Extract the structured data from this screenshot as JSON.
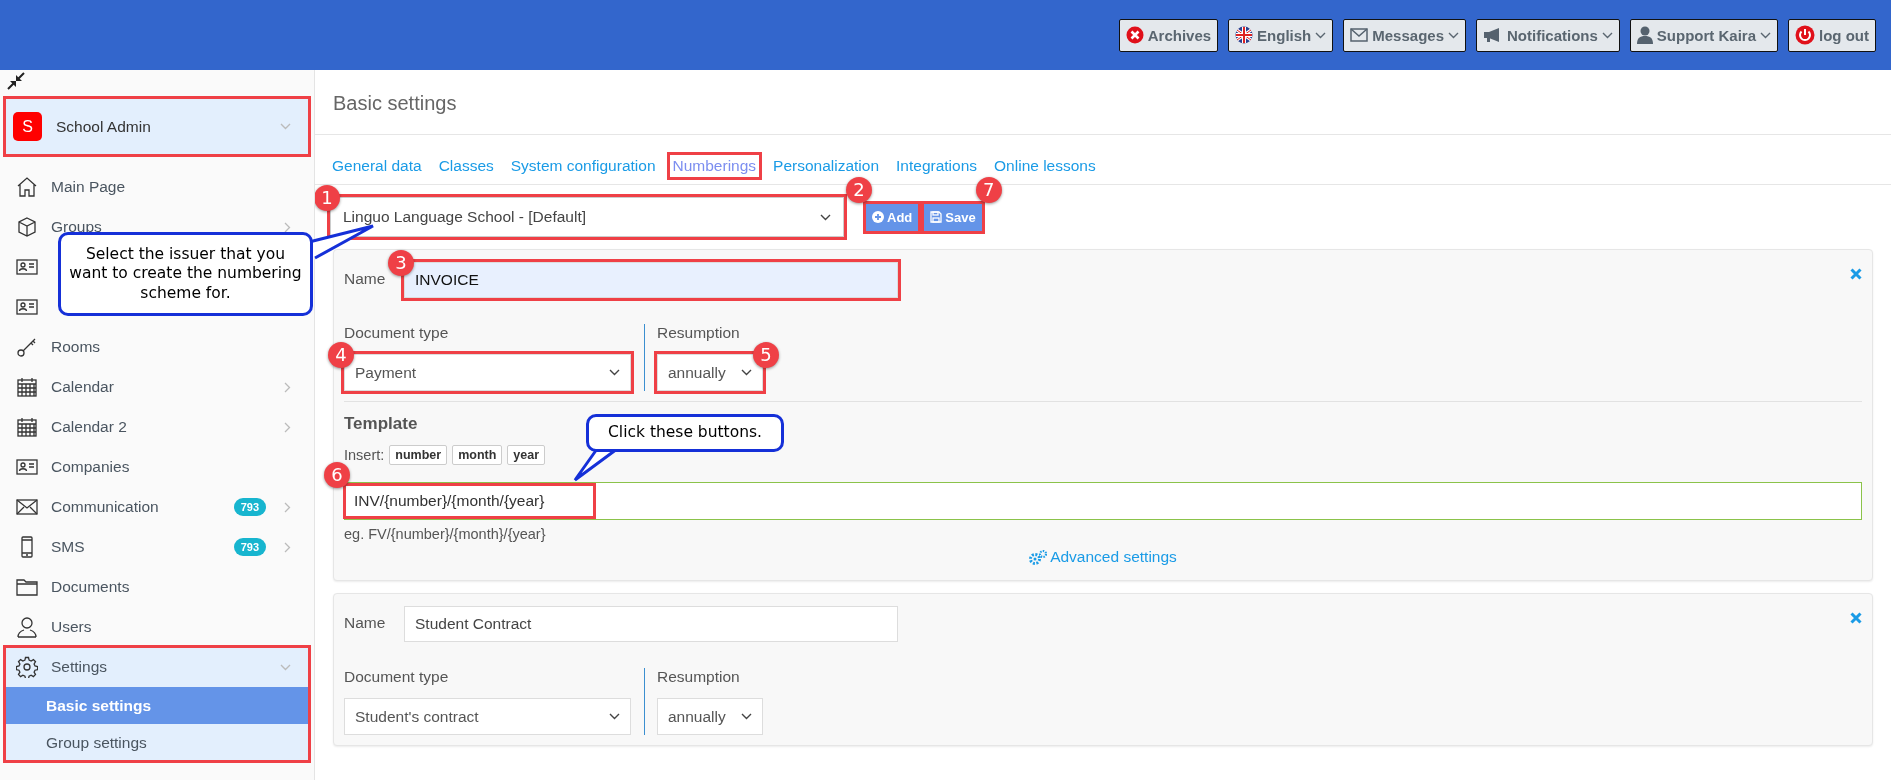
{
  "top_bar": {
    "buttons": [
      {
        "kind": "archives",
        "label": "Archives",
        "dropdown": false
      },
      {
        "kind": "language",
        "label": "English",
        "dropdown": true
      },
      {
        "kind": "messages",
        "label": "Messages",
        "dropdown": true
      },
      {
        "kind": "notifications",
        "label": "Notifications",
        "dropdown": true
      },
      {
        "kind": "user",
        "label": "Support Kaira",
        "dropdown": true
      },
      {
        "kind": "logout",
        "label": "log out",
        "dropdown": false
      }
    ]
  },
  "sidebar": {
    "organization": {
      "initial": "S",
      "name": "School Admin",
      "highlighted": true
    },
    "items": [
      {
        "kind": "home",
        "label": "Main Page",
        "submenu": false
      },
      {
        "kind": "cube",
        "label": "Groups",
        "submenu": true
      },
      {
        "kind": "card"
      },
      {
        "kind": "card"
      },
      {
        "kind": "key",
        "label": "Rooms",
        "submenu": false
      },
      {
        "kind": "calendar",
        "label": "Calendar",
        "submenu": true
      },
      {
        "kind": "calendar",
        "label": "Calendar 2",
        "submenu": true
      },
      {
        "kind": "card",
        "label": "Companies",
        "submenu": false
      },
      {
        "kind": "envelope",
        "label": "Communication",
        "badge": "793",
        "submenu": true
      },
      {
        "kind": "phone",
        "label": "SMS",
        "badge": "793",
        "submenu": true
      },
      {
        "kind": "folder",
        "label": "Documents",
        "submenu": false
      },
      {
        "kind": "user",
        "label": "Users",
        "submenu": false
      },
      {
        "kind": "gear",
        "label": "Settings",
        "submenu": true,
        "expanded": true,
        "highlighted": true,
        "children": [
          {
            "label": "Basic settings",
            "selected": true
          },
          {
            "label": "Group settings",
            "selected": false
          }
        ]
      }
    ]
  },
  "main": {
    "title": "Basic settings",
    "tabs": [
      {
        "label": "General data",
        "selected": false,
        "highlighted": false
      },
      {
        "label": "Classes",
        "selected": false,
        "highlighted": false
      },
      {
        "label": "System configuration",
        "selected": false,
        "highlighted": false
      },
      {
        "label": "Numberings",
        "selected": true,
        "highlighted": true
      },
      {
        "label": "Personalization",
        "selected": false,
        "highlighted": false
      },
      {
        "label": "Integrations",
        "selected": false,
        "highlighted": false
      },
      {
        "label": "Online lessons",
        "selected": false,
        "highlighted": false
      }
    ],
    "issuer_select": {
      "value": "Linguo Language School - [Default]",
      "step": "1"
    },
    "actions": [
      {
        "kind": "add",
        "label": "Add",
        "step": "2"
      },
      {
        "kind": "save",
        "label": "Save",
        "step": "7"
      }
    ],
    "numberings": [
      {
        "name_label": "Name",
        "name": {
          "value": "INVOICE",
          "step": "3",
          "focused": true
        },
        "document_type_label": "Document type",
        "document_type": {
          "value": "Payment",
          "step": "4"
        },
        "resumption_label": "Resumption",
        "resumption": {
          "value": "annually",
          "step": "5"
        },
        "template": {
          "title": "Template",
          "insert_label": "Insert:",
          "insert_buttons": [
            "number",
            "month",
            "year"
          ],
          "value": "INV/{number}/{month/{year}",
          "step": "6",
          "example": "eg. FV/{number}/{month}/{year}"
        },
        "advanced_link": "Advanced settings"
      },
      {
        "name_label": "Name",
        "name": {
          "value": "Student Contract",
          "focused": false
        },
        "document_type_label": "Document type",
        "document_type": {
          "value": "Student's contract"
        },
        "resumption_label": "Resumption",
        "resumption": {
          "value": "annually"
        }
      }
    ]
  },
  "callouts": [
    {
      "text": "Select the issuer that you want to create the numbering scheme for."
    },
    {
      "text": "Click these buttons."
    }
  ]
}
